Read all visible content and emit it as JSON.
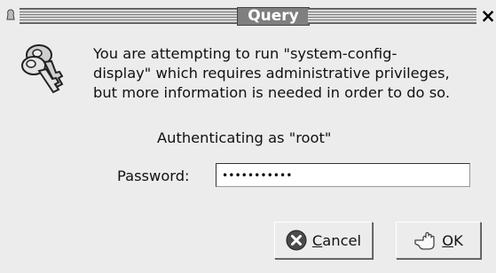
{
  "window": {
    "title": "Query",
    "close_symbol": "×"
  },
  "icons": {
    "window_menu": "window-menu-icon",
    "keys": "keys-icon",
    "cancel": "cancel-icon",
    "ok": "hand-pointer-icon"
  },
  "message": {
    "line1": "You are attempting to run \"system-config-",
    "line2": "display\" which requires administrative privileges,",
    "line3": "but more information is needed in order to do so."
  },
  "auth": {
    "text": "Authenticating as \"root\""
  },
  "password": {
    "label": "Password:",
    "value": "•••••••••••"
  },
  "buttons": {
    "cancel": {
      "mnemonic": "C",
      "rest": "ancel"
    },
    "ok": {
      "mnemonic": "O",
      "rest": "K"
    }
  }
}
